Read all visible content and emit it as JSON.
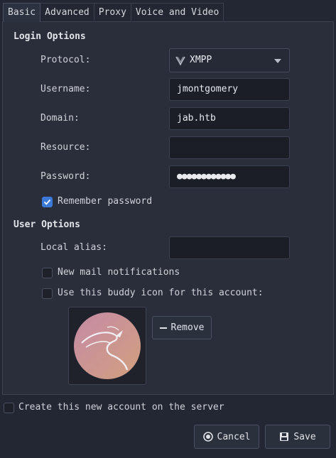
{
  "tabs": [
    {
      "label": "Basic",
      "active": true
    },
    {
      "label": "Advanced",
      "active": false
    },
    {
      "label": "Proxy",
      "active": false
    },
    {
      "label": "Voice and Video",
      "active": false
    }
  ],
  "login": {
    "title": "Login Options",
    "protocol_label": "Protocol:",
    "protocol_value": "XMPP",
    "username_label": "Username:",
    "username_value": "jmontgomery",
    "domain_label": "Domain:",
    "domain_value": "jab.htb",
    "resource_label": "Resource:",
    "resource_value": "",
    "password_label": "Password:",
    "password_value": "●●●●●●●●●●●●",
    "remember_label": "Remember password",
    "remember_checked": true
  },
  "user": {
    "title": "User Options",
    "alias_label": "Local alias:",
    "alias_value": "",
    "mail_label": "New mail notifications",
    "mail_checked": false,
    "buddy_label": "Use this buddy icon for this account:",
    "buddy_checked": false,
    "remove_label": "Remove"
  },
  "footer": {
    "create_label": "Create this new account on the server",
    "create_checked": false,
    "cancel_label": "Cancel",
    "save_label": "Save"
  },
  "colors": {
    "accent": "#3b7ad8",
    "background": "#232733",
    "panel": "#2a2e3a"
  }
}
